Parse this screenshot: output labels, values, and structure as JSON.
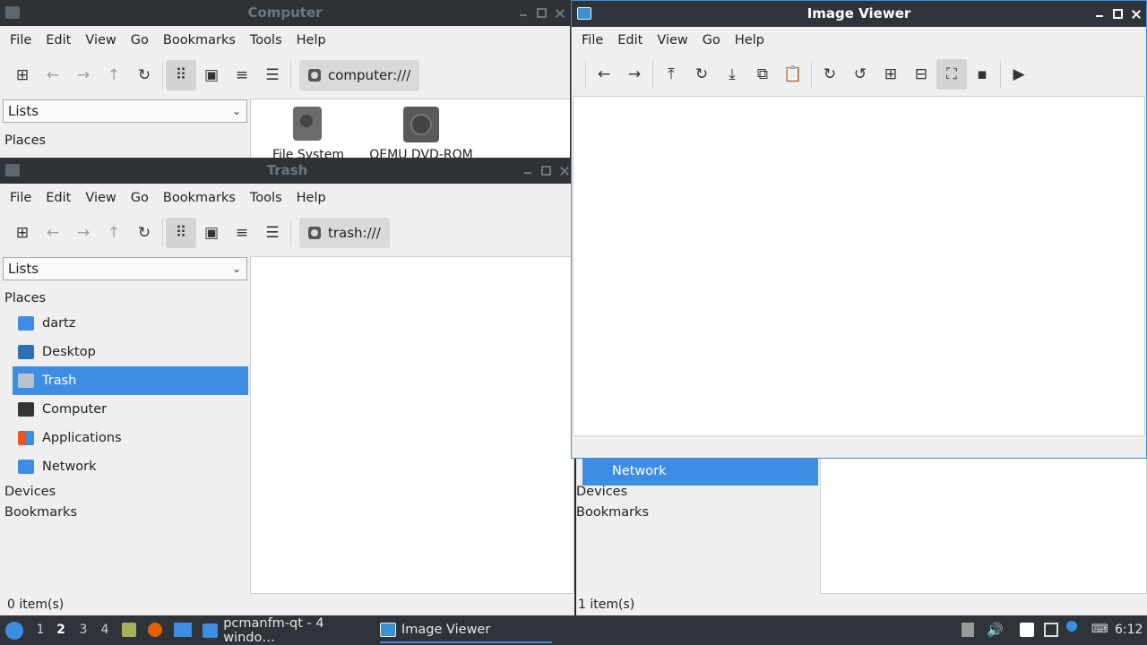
{
  "computer_window": {
    "title": "Computer",
    "menu": [
      "File",
      "Edit",
      "View",
      "Go",
      "Bookmarks",
      "Tools",
      "Help"
    ],
    "path": "computer:///",
    "side_combo": "Lists",
    "places_label": "Places",
    "items": [
      {
        "label": "File System"
      },
      {
        "label": "QEMU DVD-ROM"
      }
    ]
  },
  "trash_window": {
    "title": "Trash",
    "menu": [
      "File",
      "Edit",
      "View",
      "Go",
      "Bookmarks",
      "Tools",
      "Help"
    ],
    "path": "trash:///",
    "side_combo": "Lists",
    "places_label": "Places",
    "places": [
      {
        "label": "dartz",
        "icon": "home-folder-icon",
        "color": "#3d8ee3"
      },
      {
        "label": "Desktop",
        "icon": "desktop-icon",
        "color": "#2f6fb8"
      },
      {
        "label": "Trash",
        "icon": "trash-icon",
        "color": "#b9c3cc"
      },
      {
        "label": "Computer",
        "icon": "computer-icon",
        "color": "#333333"
      },
      {
        "label": "Applications",
        "icon": "applications-icon",
        "color": "#e95420"
      },
      {
        "label": "Network",
        "icon": "network-folder-icon",
        "color": "#3d8ee3"
      }
    ],
    "devices_label": "Devices",
    "bookmarks_label": "Bookmarks",
    "status": "0 item(s)"
  },
  "background_window": {
    "network_label": "Network",
    "devices_label": "Devices",
    "bookmarks_label": "Bookmarks",
    "status": "1 item(s)"
  },
  "image_viewer": {
    "title": "Image Viewer",
    "menu": [
      "File",
      "Edit",
      "View",
      "Go",
      "Help"
    ]
  },
  "taskbar": {
    "workspaces": [
      "1",
      "2",
      "3",
      "4"
    ],
    "active_workspace": "2",
    "tasks": [
      {
        "label": "pcmanfm-qt - 4 windo…",
        "icon": "folder-icon"
      },
      {
        "label": "Image Viewer",
        "icon": "image-viewer-icon"
      }
    ],
    "clock": "6:12"
  },
  "colors": {
    "accent": "#3d8ee3",
    "titlebar": "#2f343a",
    "panel": "#2f343a"
  }
}
